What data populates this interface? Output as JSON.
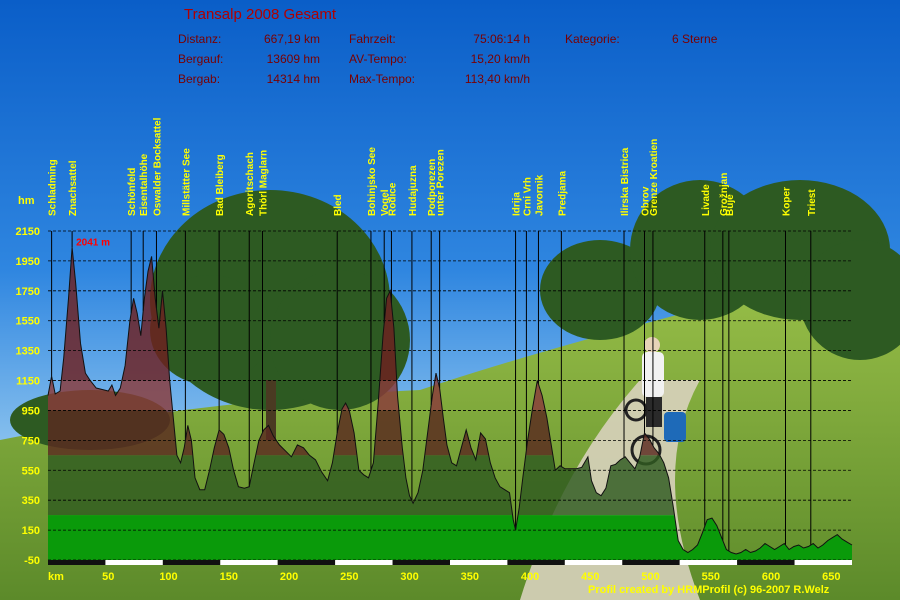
{
  "header": {
    "title": "Transalp 2008 Gesamt",
    "stats": [
      {
        "label": "Distanz:",
        "value": "667,19 km"
      },
      {
        "label": "Bergauf:",
        "value": "13609 hm"
      },
      {
        "label": "Bergab:",
        "value": "14314 hm"
      },
      {
        "label": "Fahrzeit:",
        "value": "75:06:14 h"
      },
      {
        "label": "AV-Tempo:",
        "value": "15,20 km/h"
      },
      {
        "label": "Max-Tempo:",
        "value": "113,40 km/h"
      },
      {
        "label": "Kategorie:",
        "value": "6 Sterne"
      }
    ]
  },
  "credit": "Profil created by HRMProfil (c) 96-2007 R.Welz",
  "colors": {
    "axis_text": "#ffff00",
    "header_text": "#7a0000",
    "title_text": "#b00000",
    "max_label": "#ff0000",
    "band_high": "#6e2020",
    "band_mid_high": "#8a3a3a",
    "band_mid": "#5a2a20",
    "band_low": "#2f5a20",
    "band_bottom": "#0a9a0a"
  },
  "chart_data": {
    "type": "area",
    "title": "",
    "xlabel": "km",
    "ylabel": "hm",
    "xlim": [
      0,
      667.19
    ],
    "ylim": [
      -50,
      2150
    ],
    "x_ticks": [
      50,
      100,
      150,
      200,
      250,
      300,
      350,
      400,
      450,
      500,
      550,
      600,
      650
    ],
    "y_ticks": [
      -50,
      150,
      350,
      550,
      750,
      950,
      1150,
      1350,
      1550,
      1750,
      1950,
      2150
    ],
    "grid": true,
    "max_annotation": {
      "text": "2041 m",
      "x": 20,
      "y": 2041
    },
    "profile": [
      [
        0,
        1050
      ],
      [
        3,
        1180
      ],
      [
        6,
        1060
      ],
      [
        10,
        1080
      ],
      [
        13,
        1300
      ],
      [
        17,
        1700
      ],
      [
        20,
        2041
      ],
      [
        23,
        1800
      ],
      [
        27,
        1400
      ],
      [
        31,
        1200
      ],
      [
        35,
        1150
      ],
      [
        40,
        1100
      ],
      [
        45,
        1090
      ],
      [
        50,
        1080
      ],
      [
        53,
        1120
      ],
      [
        56,
        1050
      ],
      [
        60,
        1100
      ],
      [
        64,
        1250
      ],
      [
        68,
        1550
      ],
      [
        71,
        1700
      ],
      [
        74,
        1600
      ],
      [
        77,
        1450
      ],
      [
        80,
        1700
      ],
      [
        83,
        1880
      ],
      [
        86,
        1980
      ],
      [
        89,
        1700
      ],
      [
        92,
        1500
      ],
      [
        95,
        1750
      ],
      [
        98,
        1500
      ],
      [
        101,
        1150
      ],
      [
        104,
        900
      ],
      [
        107,
        650
      ],
      [
        110,
        600
      ],
      [
        113,
        700
      ],
      [
        116,
        850
      ],
      [
        119,
        750
      ],
      [
        122,
        500
      ],
      [
        126,
        420
      ],
      [
        130,
        420
      ],
      [
        134,
        550
      ],
      [
        138,
        700
      ],
      [
        142,
        820
      ],
      [
        146,
        790
      ],
      [
        150,
        700
      ],
      [
        154,
        550
      ],
      [
        158,
        440
      ],
      [
        163,
        430
      ],
      [
        167,
        440
      ],
      [
        171,
        600
      ],
      [
        175,
        750
      ],
      [
        179,
        820
      ],
      [
        183,
        850
      ],
      [
        187,
        780
      ],
      [
        192,
        720
      ],
      [
        197,
        680
      ],
      [
        202,
        640
      ],
      [
        207,
        720
      ],
      [
        212,
        700
      ],
      [
        217,
        650
      ],
      [
        222,
        620
      ],
      [
        227,
        540
      ],
      [
        232,
        480
      ],
      [
        236,
        600
      ],
      [
        240,
        800
      ],
      [
        244,
        960
      ],
      [
        247,
        1000
      ],
      [
        250,
        950
      ],
      [
        254,
        800
      ],
      [
        258,
        550
      ],
      [
        262,
        520
      ],
      [
        266,
        500
      ],
      [
        270,
        600
      ],
      [
        274,
        1000
      ],
      [
        278,
        1450
      ],
      [
        281,
        1700
      ],
      [
        284,
        1750
      ],
      [
        287,
        1500
      ],
      [
        290,
        1050
      ],
      [
        294,
        700
      ],
      [
        297,
        500
      ],
      [
        300,
        380
      ],
      [
        303,
        330
      ],
      [
        307,
        400
      ],
      [
        311,
        550
      ],
      [
        315,
        800
      ],
      [
        319,
        1050
      ],
      [
        322,
        1200
      ],
      [
        325,
        1100
      ],
      [
        328,
        900
      ],
      [
        331,
        720
      ],
      [
        335,
        600
      ],
      [
        339,
        580
      ],
      [
        343,
        700
      ],
      [
        347,
        820
      ],
      [
        351,
        700
      ],
      [
        355,
        620
      ],
      [
        359,
        800
      ],
      [
        363,
        760
      ],
      [
        367,
        600
      ],
      [
        371,
        500
      ],
      [
        375,
        440
      ],
      [
        379,
        420
      ],
      [
        383,
        400
      ],
      [
        386,
        220
      ],
      [
        388,
        150
      ],
      [
        391,
        300
      ],
      [
        394,
        500
      ],
      [
        398,
        750
      ],
      [
        402,
        960
      ],
      [
        406,
        1150
      ],
      [
        410,
        1050
      ],
      [
        414,
        900
      ],
      [
        418,
        700
      ],
      [
        421,
        550
      ],
      [
        425,
        580
      ],
      [
        429,
        560
      ],
      [
        433,
        560
      ],
      [
        438,
        560
      ],
      [
        443,
        570
      ],
      [
        448,
        640
      ],
      [
        451,
        480
      ],
      [
        455,
        400
      ],
      [
        459,
        380
      ],
      [
        463,
        430
      ],
      [
        467,
        580
      ],
      [
        471,
        590
      ],
      [
        475,
        620
      ],
      [
        479,
        640
      ],
      [
        483,
        600
      ],
      [
        487,
        560
      ],
      [
        491,
        640
      ],
      [
        495,
        800
      ],
      [
        499,
        760
      ],
      [
        503,
        700
      ],
      [
        507,
        660
      ],
      [
        511,
        600
      ],
      [
        515,
        500
      ],
      [
        519,
        300
      ],
      [
        523,
        80
      ],
      [
        527,
        20
      ],
      [
        531,
        0
      ],
      [
        535,
        20
      ],
      [
        539,
        50
      ],
      [
        543,
        130
      ],
      [
        547,
        220
      ],
      [
        551,
        230
      ],
      [
        555,
        180
      ],
      [
        559,
        100
      ],
      [
        563,
        20
      ],
      [
        567,
        0
      ],
      [
        571,
        -10
      ],
      [
        575,
        0
      ],
      [
        579,
        20
      ],
      [
        583,
        0
      ],
      [
        587,
        10
      ],
      [
        591,
        30
      ],
      [
        595,
        60
      ],
      [
        599,
        40
      ],
      [
        603,
        20
      ],
      [
        607,
        40
      ],
      [
        611,
        60
      ],
      [
        615,
        20
      ],
      [
        619,
        40
      ],
      [
        623,
        50
      ],
      [
        627,
        30
      ],
      [
        631,
        40
      ],
      [
        635,
        60
      ],
      [
        639,
        30
      ],
      [
        643,
        50
      ],
      [
        647,
        80
      ],
      [
        651,
        100
      ],
      [
        655,
        120
      ],
      [
        659,
        90
      ],
      [
        663,
        70
      ],
      [
        667.19,
        50
      ]
    ],
    "waypoints": [
      {
        "name": "Schladming",
        "x": 3
      },
      {
        "name": "Znachsattel",
        "x": 20
      },
      {
        "name": "Schönfeld",
        "x": 69
      },
      {
        "name": "Eisentalhöhe",
        "x": 79
      },
      {
        "name": "Oswalder Bocksattel",
        "x": 90
      },
      {
        "name": "Millstätter See",
        "x": 114
      },
      {
        "name": "Bad Bleiberg",
        "x": 142
      },
      {
        "name": "Agoritschach",
        "x": 167
      },
      {
        "name": "Thörl Maglarn",
        "x": 178
      },
      {
        "name": "Bled",
        "x": 240
      },
      {
        "name": "Bohinjsko See",
        "x": 268
      },
      {
        "name": "Vogel",
        "x": 279
      },
      {
        "name": "Rodice",
        "x": 285
      },
      {
        "name": "Hudajuzna",
        "x": 302
      },
      {
        "name": "Podporezen",
        "x": 318
      },
      {
        "name": "unter Porezen",
        "x": 325
      },
      {
        "name": "Idrija",
        "x": 388
      },
      {
        "name": "Crni Vrh",
        "x": 397
      },
      {
        "name": "Javornik",
        "x": 407
      },
      {
        "name": "Predjama",
        "x": 426
      },
      {
        "name": "Ilirska Bistrica",
        "x": 478
      },
      {
        "name": "Obrov",
        "x": 495
      },
      {
        "name": "Grenze Kroatien",
        "x": 502
      },
      {
        "name": "Livade",
        "x": 545
      },
      {
        "name": "Grožnjan",
        "x": 560
      },
      {
        "name": "Buje",
        "x": 565
      },
      {
        "name": "Koper",
        "x": 612
      },
      {
        "name": "Triest",
        "x": 633
      }
    ]
  }
}
